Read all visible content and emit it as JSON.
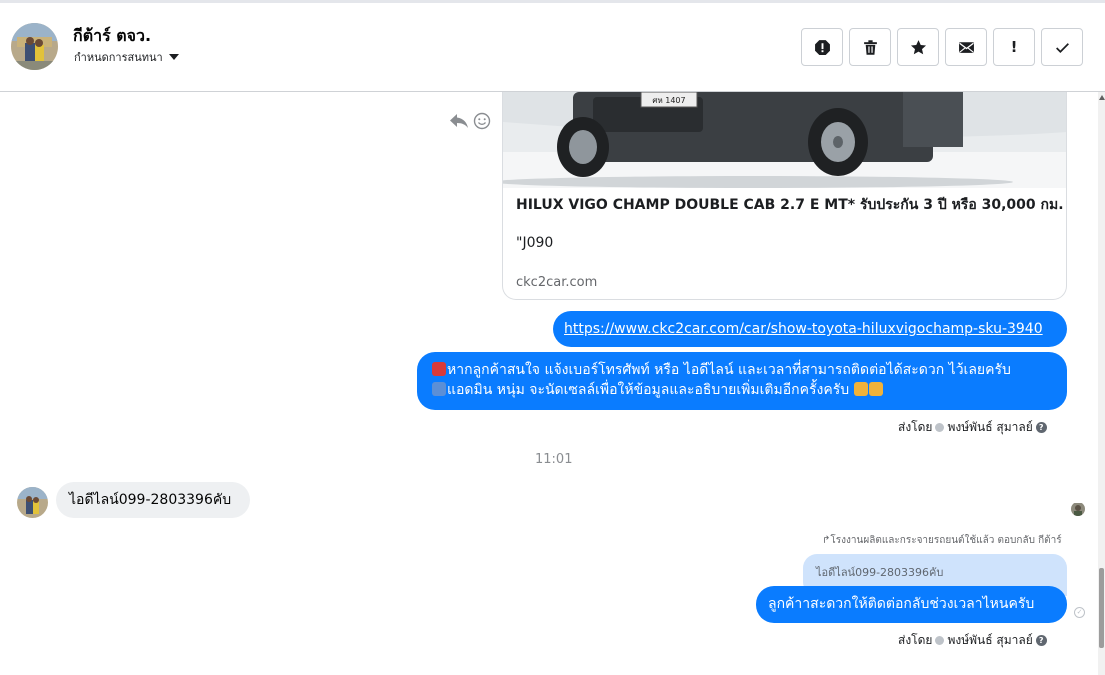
{
  "header": {
    "contact_name": "กีต้าร์ ตจว.",
    "settings_label": "กำหนดการสนทนา",
    "toolbar": [
      {
        "name": "report-icon",
        "label": "Report"
      },
      {
        "name": "trash-icon",
        "label": "Delete"
      },
      {
        "name": "star-icon",
        "label": "Star"
      },
      {
        "name": "mail-icon",
        "label": "Mark unread"
      },
      {
        "name": "exclamation-icon",
        "glyph": "!"
      },
      {
        "name": "check-icon",
        "label": "Done"
      }
    ]
  },
  "messages": {
    "card": {
      "title": "HILUX VIGO CHAMP DOUBLE CAB 2.7 E MT* รับประกัน 3 ปี หรือ 30,000 กม.",
      "description": "\"J090",
      "domain": "ckc2car.com",
      "plate_text": "ศห 1407"
    },
    "link_text": "https://www.ckc2car.com/car/show-toyota-hiluxvigochamp-sku-3940",
    "long_line1": "หากลูกค้าสนใจ แจ้งเบอร์โทรศัพท์ หรือ ไอดีไลน์ และเวลาที่สามารถติดต่อได้สะดวก ไว้เลยครับ",
    "long_line2": "แอดมิน หนุ่ม จะนัดเซลล์เพื่อให้ข้อมูลและอธิบายเพิ่มเติมอีกครั้งครับ",
    "sent_by_label": "ส่งโดย",
    "sent_by_name": "พงษ์พันธ์ สุมาลย์",
    "timestamp": "11:01",
    "incoming_text": "ไอดีไลน์099-2803396คับ",
    "reply_meta": "โรงงานผลิตและกระจายรถยนต์ใช้แล้ว ตอบกลับ กีต้าร์",
    "quoted_text": "ไอดีไลน์099-2803396คับ",
    "reply_text": "ลูกค้าาสะดวกให้ติดต่อกลับช่วงเวลาไหนครับ",
    "help_glyph": "?"
  },
  "colors": {
    "outgoing_bubble": "#0a7cff",
    "incoming_bubble": "#eef0f2",
    "quoted_bubble": "#cfe3fc"
  }
}
